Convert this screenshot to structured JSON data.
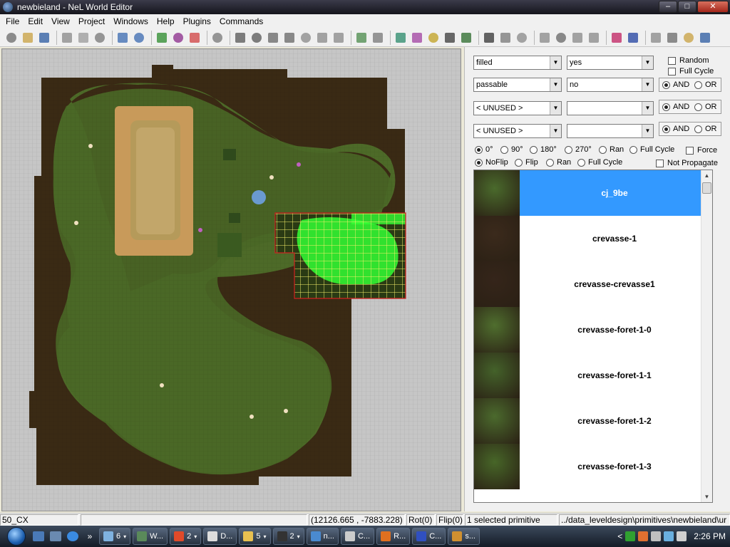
{
  "window": {
    "title": "newbieland - NeL World Editor",
    "buttons": {
      "minimize": "–",
      "maximize": "□",
      "close": "✕"
    }
  },
  "menu": [
    "File",
    "Edit",
    "View",
    "Project",
    "Windows",
    "Help",
    "Plugins",
    "Commands"
  ],
  "toolbar": {
    "icons": [
      "new-file-icon",
      "open-folder-icon",
      "save-icon",
      "|",
      "cut-icon",
      "copy-icon",
      "paste-icon",
      "|",
      "undo-icon",
      "redo-icon",
      "|",
      "grid-icon",
      "select-region-icon",
      "color-icon",
      "|",
      "connect-icon",
      "|",
      "pointer-icon",
      "move-icon",
      "rotate-icon",
      "scale-icon",
      "snap-icon",
      "target-icon",
      "circle-icon",
      "|",
      "tree-icon",
      "link-icon",
      "|",
      "sphere-icon",
      "gear-icon",
      "star-icon",
      "spiral-icon",
      "camera-icon",
      "|",
      "hub-icon",
      "grid-large-icon",
      "grid-fine-icon",
      "|",
      "disk-icon",
      "zoom-icon",
      "frame-icon",
      "edit-icon",
      "|",
      "brush-icon",
      "dots-icon",
      "|",
      "properties-icon",
      "book-icon",
      "color-map-icon",
      "document-icon"
    ]
  },
  "filters": {
    "row1": {
      "field": "filled",
      "value": "yes"
    },
    "row2": {
      "field": "passable",
      "value": "no"
    },
    "row3": {
      "field": "< UNUSED >",
      "value": ""
    },
    "row4": {
      "field": "< UNUSED >",
      "value": ""
    },
    "random_label": "Random",
    "full_cycle_label": "Full Cycle",
    "and_label": "AND",
    "or_label": "OR"
  },
  "rotation": {
    "options": [
      "0°",
      "90°",
      "180°",
      "270°",
      "Ran",
      "Full Cycle"
    ],
    "selected": 0,
    "force_label": "Force"
  },
  "flip": {
    "options": [
      "NoFlip",
      "Flip",
      "Ran",
      "Full Cycle"
    ],
    "selected": 0,
    "not_propagate_label": "Not Propagate"
  },
  "tiles": [
    {
      "name": "cj_9be",
      "selected": true,
      "thumb": "#4a6a2c"
    },
    {
      "name": "crevasse-1",
      "selected": false,
      "thumb": "#3b2a1c"
    },
    {
      "name": "crevasse-crevasse1",
      "selected": false,
      "thumb": "#35251a"
    },
    {
      "name": "crevasse-foret-1-0",
      "selected": false,
      "thumb": "#4f6e2e"
    },
    {
      "name": "crevasse-foret-1-1",
      "selected": false,
      "thumb": "#44622a"
    },
    {
      "name": "crevasse-foret-1-2",
      "selected": false,
      "thumb": "#4b6a2d"
    },
    {
      "name": "crevasse-foret-1-3",
      "selected": false,
      "thumb": "#476628"
    }
  ],
  "status": {
    "layer": "50_CX",
    "empty": "",
    "coords": "(12126.665 , -7883.228)",
    "rot": "Rot(0)",
    "flip": "Flip(0)",
    "selection": "1 selected primitive",
    "path": "../data_leveldesign\\primitives\\newbieland\\ur"
  },
  "taskbar": {
    "quicklaunch_more": "»",
    "tasks": [
      {
        "label": "6",
        "arrow": "▾",
        "color": "#7fb2e0"
      },
      {
        "label": "W...",
        "arrow": "",
        "color": "#5a8a5a"
      },
      {
        "label": "2",
        "arrow": "▾",
        "color": "#e04a2a"
      },
      {
        "label": "D...",
        "arrow": "",
        "color": "#dddddd"
      },
      {
        "label": "5",
        "arrow": "▾",
        "color": "#e8c050"
      },
      {
        "label": "2",
        "arrow": "▾",
        "color": "#333333"
      },
      {
        "label": "n...",
        "arrow": "",
        "color": "#4a8ad0"
      },
      {
        "label": "C...",
        "arrow": "",
        "color": "#cccccc"
      },
      {
        "label": "R...",
        "arrow": "",
        "color": "#e07020"
      },
      {
        "label": "C...",
        "arrow": "",
        "color": "#3050c0"
      },
      {
        "label": "s...",
        "arrow": "",
        "color": "#d09030"
      }
    ],
    "tray_expand": "<",
    "clock": "2:26 PM"
  },
  "colors": {
    "selection_blue": "#3399ff",
    "grid_yellow": "#f6f06a",
    "selected_tile_green": "#33ff33",
    "map_grass": "#4d6a28",
    "map_dirt": "#3a2a14"
  }
}
